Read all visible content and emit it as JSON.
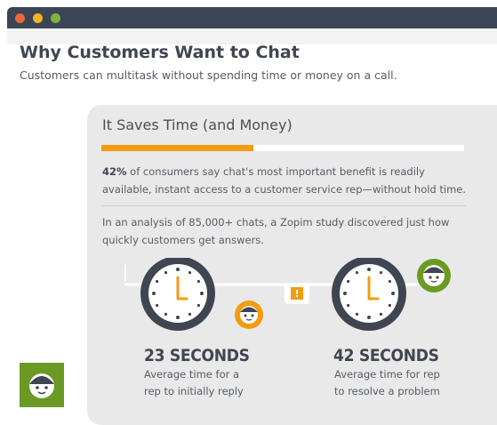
{
  "window": {
    "controls": [
      "close",
      "minimize",
      "maximize"
    ]
  },
  "header": {
    "title": "Why Customers Want to Chat",
    "subtitle": "Customers can multitask without spending time or money on a call."
  },
  "card": {
    "title": "It Saves Time (and Money)",
    "progress_percent": 42,
    "stat_percent": "42%",
    "stat_rest": " of consumers say chat's most important benefit is readily available, instant access to a customer service rep—without hold time.",
    "study_text": "In an analysis of 85,000+ chats, a Zopim study discovered just how quickly customers get answers."
  },
  "metrics": [
    {
      "value": "23 SECONDS",
      "line1": "Average time for a",
      "line2": "rep to initially reply",
      "bubble": "?"
    },
    {
      "value": "42 SECONDS",
      "line1": "Average time for rep",
      "line2": "to resolve a problem",
      "bubble": "!"
    }
  ],
  "colors": {
    "accent_orange": "#f39c12",
    "brand_green": "#6a9a24",
    "dark_slate": "#3f4652",
    "card_bg": "#e9e9e9",
    "window_bar": "#3b4554"
  },
  "icons": [
    "window-close-icon",
    "window-minimize-icon",
    "window-maximize-icon",
    "question-bubble-icon",
    "exclamation-bubble-icon",
    "clock-icon",
    "agent-avatar-icon",
    "zopim-logo-icon"
  ]
}
